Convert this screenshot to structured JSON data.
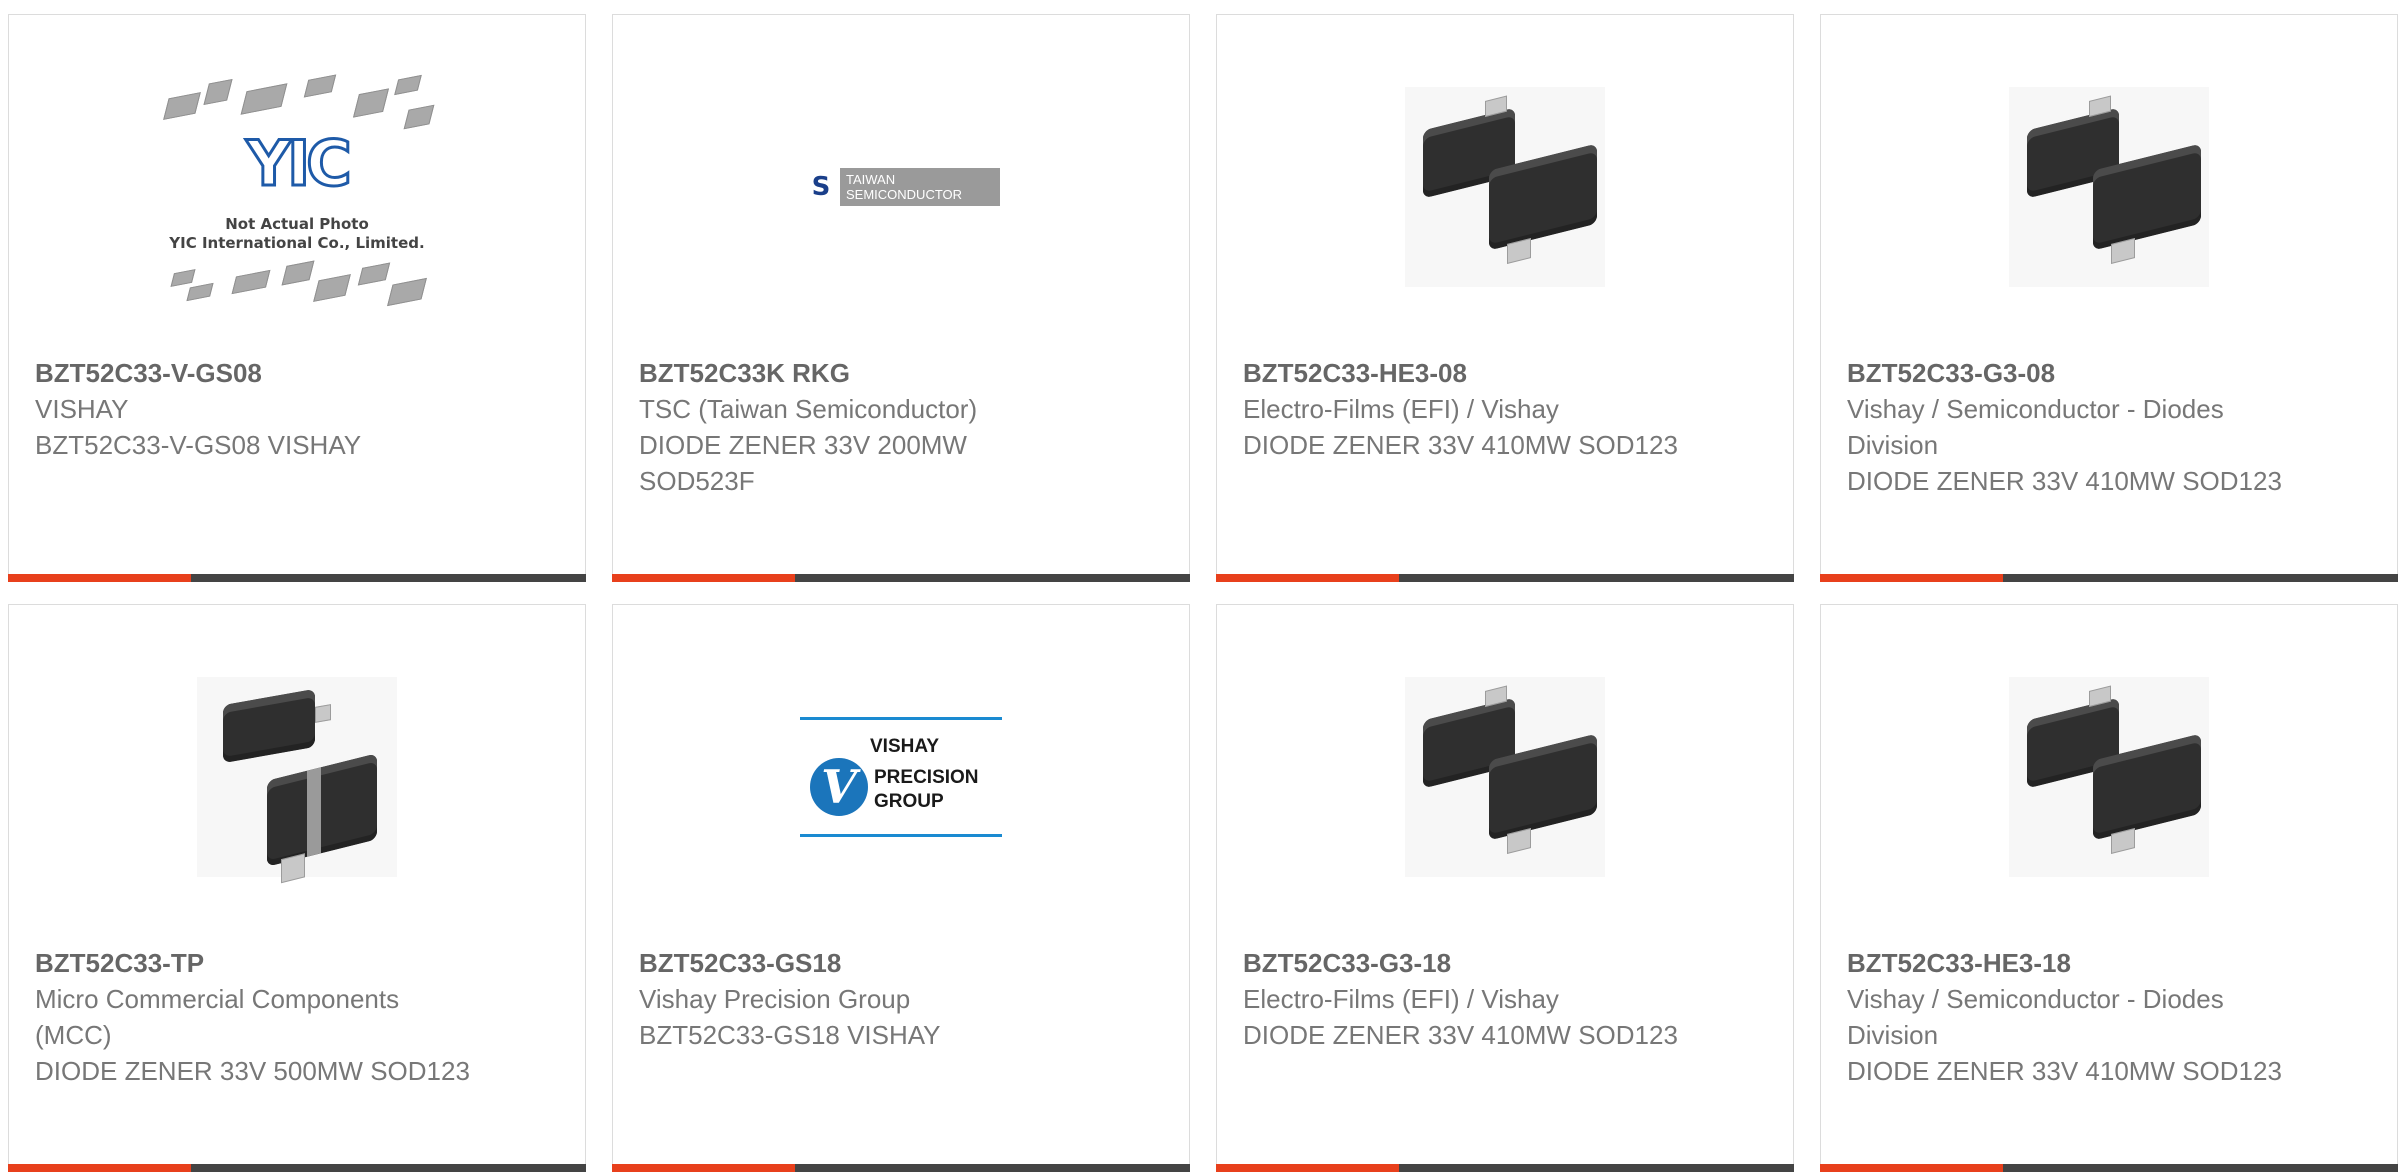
{
  "colors": {
    "accent": "#e8401c",
    "bar": "#444444",
    "text": "#777777",
    "part_number": "#666666",
    "border": "#dcdcdc"
  },
  "products": [
    {
      "part_number": "BZT52C33-V-GS08",
      "manufacturer": "VISHAY",
      "description": "BZT52C33-V-GS08 VISHAY",
      "image": "not-actual-photo-placeholder",
      "image_caption": "Not Actual Photo",
      "image_caption2": "YIC International Co., Limited.",
      "image_logo": "YIC"
    },
    {
      "part_number": "BZT52C33K RKG",
      "manufacturer": "TSC (Taiwan Semiconductor)",
      "description": "DIODE ZENER 33V 200MW SOD523F",
      "image": "taiwan-semiconductor-logo",
      "image_logo_line1": "TAIWAN",
      "image_logo_line2": "SEMICONDUCTOR"
    },
    {
      "part_number": "BZT52C33-HE3-08",
      "manufacturer": "Electro-Films (EFI) / Vishay",
      "description": "DIODE ZENER 33V 410MW SOD123",
      "image": "sod123-diode-package-photo"
    },
    {
      "part_number": "BZT52C33-G3-08",
      "manufacturer": "Vishay / Semiconductor - Diodes Division",
      "description": "DIODE ZENER 33V 410MW SOD123",
      "image": "sod123-diode-package-photo"
    },
    {
      "part_number": "BZT52C33-TP",
      "manufacturer": "Micro Commercial Components (MCC)",
      "description": "DIODE ZENER 33V 500MW SOD123",
      "image": "sod123-diode-package-photo-mcc"
    },
    {
      "part_number": "BZT52C33-GS18",
      "manufacturer": "Vishay Precision Group",
      "description": "BZT52C33-GS18 VISHAY",
      "image": "vishay-precision-group-logo",
      "image_logo_line1": "VISHAY",
      "image_logo_line2": "PRECISION",
      "image_logo_line3": "GROUP"
    },
    {
      "part_number": "BZT52C33-G3-18",
      "manufacturer": "Electro-Films (EFI) / Vishay",
      "description": "DIODE ZENER 33V 410MW SOD123",
      "image": "sod123-diode-package-photo"
    },
    {
      "part_number": "BZT52C33-HE3-18",
      "manufacturer": "Vishay / Semiconductor - Diodes Division",
      "description": "DIODE ZENER 33V 410MW SOD123",
      "image": "sod123-diode-package-photo"
    }
  ]
}
